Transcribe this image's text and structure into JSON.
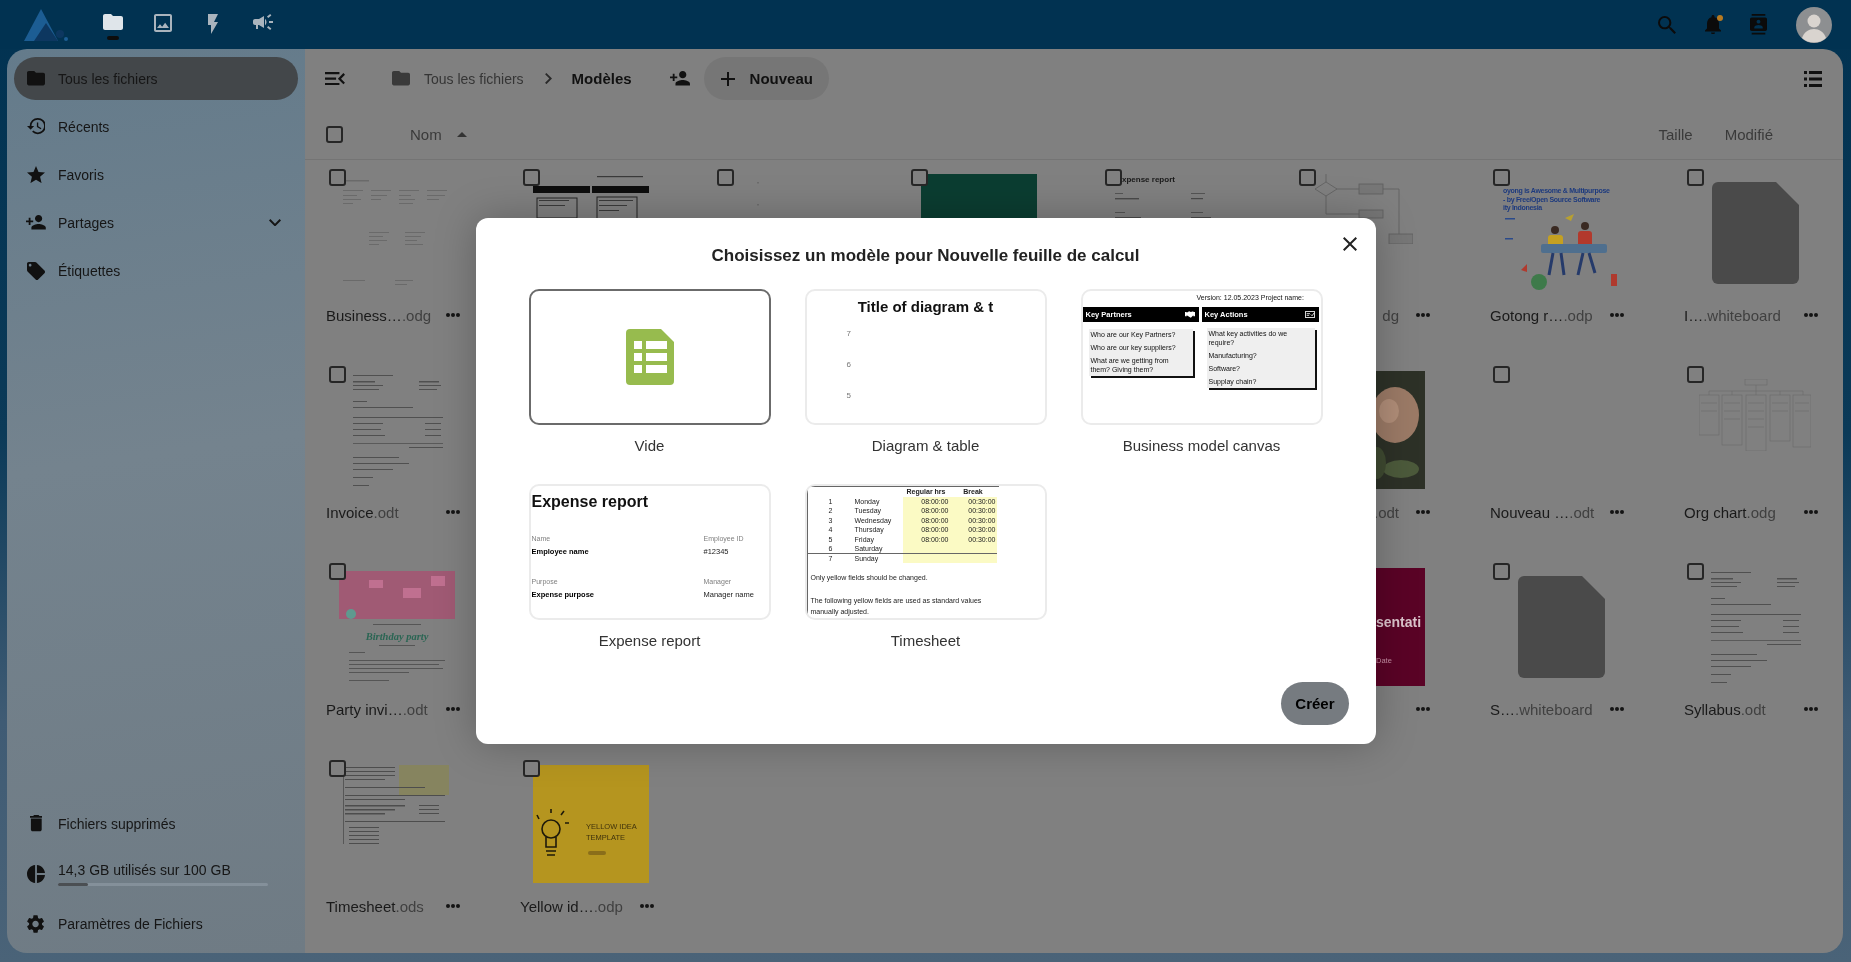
{
  "header": {
    "apps": [
      {
        "selected": true
      },
      {
        "selected": false
      },
      {
        "selected": false
      },
      {
        "selected": false
      }
    ],
    "unread_notifications": true
  },
  "sidebar": {
    "items": [
      {
        "label": "Tous les fichiers",
        "selected": true
      },
      {
        "label": "Récents",
        "selected": false
      },
      {
        "label": "Favoris",
        "selected": false
      },
      {
        "label": "Partages",
        "selected": false,
        "expanded": false
      },
      {
        "label": "Étiquettes",
        "selected": false
      }
    ],
    "trash": "Fichiers supprimés",
    "quota": {
      "label": "14,3 GB utilisés sur 100 GB",
      "level": 0.143
    },
    "settings": "Paramètres de Fichiers"
  },
  "toolbar": {
    "breadcrumbs": [
      {
        "label": "Tous les fichiers",
        "current": false
      },
      {
        "label": "Modèles",
        "current": true
      }
    ],
    "new_button": "Nouveau"
  },
  "columns": {
    "select_all": {
      "checked": false
    },
    "name": {
      "label": "Nom",
      "ascending": true
    },
    "size": "Taille",
    "modified": "Modifié"
  },
  "files": [
    {
      "left": [
        {
          "checked": false,
          "thumb": {
            "kind": "layout"
          },
          "name": "Business…",
          "ext": ".odg",
          "menu": true
        },
        {
          "checked": false,
          "thumb": {
            "kind": "canvas"
          }
        },
        {
          "checked": false,
          "thumb": {
            "kind": "chart"
          }
        },
        {
          "checked": false,
          "thumb": {
            "kind": "block",
            "color": "#0b3d31"
          }
        },
        {
          "checked": false,
          "thumb": {
            "kind": "report",
            "texts": [
              "xpense report"
            ]
          }
        },
        {
          "checked": false,
          "thumb": {
            "kind": "diagram"
          },
          "ext": "dg",
          "clipped": true,
          "menu": true
        },
        {
          "checked": false,
          "thumb": {
            "kind": "illustration",
            "texts": [
              "oyong is Awesome & Multipurpose",
              "- by Free/Open Source Software",
              "ity Indonesia"
            ]
          },
          "name": "Gotong r…",
          "ext": ".odp",
          "menu": true
        },
        {
          "checked": false,
          "thumb": {
            "kind": "file"
          },
          "name": "I…",
          "ext": ".whiteboard",
          "menu": true
        }
      ]
    },
    {
      "left": [
        {
          "checked": false,
          "thumb": {
            "kind": "document"
          },
          "name": "Invoice",
          "ext": ".odt",
          "menu": true
        }
      ],
      "right": [
        {
          "thumb": {
            "kind": "photo"
          },
          "ext": ".odt",
          "clipped": true,
          "menu": true
        },
        {
          "checked": false,
          "name": "Nouveau …",
          "ext": ".odt",
          "menu": true
        },
        {
          "checked": false,
          "thumb": {
            "kind": "orgchart"
          },
          "name": "Org chart",
          "ext": ".odg",
          "menu": true
        }
      ]
    },
    {
      "left": [
        {
          "checked": false,
          "thumb": {
            "kind": "invitation",
            "texts": [
              "Birthday party"
            ]
          },
          "name": "Party invi…",
          "ext": ".odt",
          "menu": true
        }
      ],
      "right": [
        {
          "thumb": {
            "kind": "slide",
            "color": "#5a0326",
            "texts": [
              "sentati",
              "Date"
            ]
          },
          "menu": true
        },
        {
          "checked": false,
          "thumb": {
            "kind": "file"
          },
          "name": "S…",
          "ext": ".whiteboard",
          "menu": true
        },
        {
          "checked": false,
          "thumb": {
            "kind": "document"
          },
          "name": "Syllabus",
          "ext": ".odt",
          "menu": true
        }
      ]
    },
    {
      "left": [
        {
          "checked": false,
          "thumb": {
            "kind": "timesheet"
          },
          "name": "Timesheet",
          "ext": ".ods",
          "menu": true
        },
        {
          "checked": false,
          "thumb": {
            "kind": "poster",
            "color": "#b5951f",
            "texts": [
              "YELLOW IDEA TEMPLATE"
            ]
          },
          "name": "Yellow id…",
          "ext": ".odp",
          "menu": true
        }
      ]
    }
  ],
  "dialog": {
    "title": "Choisissez un modèle pour Nouvelle feuille de calcul",
    "templates": [
      {
        "kind": "blank",
        "label": "Vide",
        "selected": true
      },
      {
        "kind": "chart",
        "label": "Diagram & table",
        "selected": false,
        "title": "Title of diagram & t",
        "ticks": [
          "7",
          "6",
          "5"
        ]
      },
      {
        "kind": "canvas",
        "label": "Business model canvas",
        "selected": false,
        "version": "Version: 12.05.2023 Project name:",
        "sections": [
          {
            "heading": "Key Partners",
            "notes": [
              "Who are our Key Partners?",
              "Who are our key suppliers?",
              "What are we getting from them? Giving them?"
            ]
          },
          {
            "heading": "Key Actions",
            "notes": [
              "What key activities do we require?",
              "Manufacturing?",
              "Software?",
              "Supplay chain?"
            ]
          }
        ]
      },
      {
        "kind": "form",
        "label": "Expense report",
        "selected": false,
        "title": "Expense report",
        "fields": [
          {
            "label": "Name",
            "value": "Employee name",
            "bold": true
          },
          {
            "label": "Employee ID",
            "value": "#12345",
            "bold": false
          },
          {
            "label": "Purpose",
            "value": "Expense purpose",
            "bold": true
          },
          {
            "label": "Manager",
            "value": "Manager name",
            "bold": false
          }
        ]
      },
      {
        "kind": "table",
        "label": "Timesheet",
        "selected": false,
        "headers": [
          "Regular hrs",
          "Break"
        ],
        "rows": [
          {
            "num": "1",
            "day": "Monday",
            "hours": "08:00:00",
            "break": "00:30:00"
          },
          {
            "num": "2",
            "day": "Tuesday",
            "hours": "08:00:00",
            "break": "00:30:00"
          },
          {
            "num": "3",
            "day": "Wednesday",
            "hours": "08:00:00",
            "break": "00:30:00"
          },
          {
            "num": "4",
            "day": "Thursday",
            "hours": "08:00:00",
            "break": "00:30:00"
          },
          {
            "num": "5",
            "day": "Friday",
            "hours": "08:00:00",
            "break": "00:30:00"
          },
          {
            "num": "6",
            "day": "Saturday"
          },
          {
            "num": "7",
            "day": "Sunday"
          }
        ],
        "notes": [
          "Only yellow fields should be changed.",
          "The following yellow fields are used as standard values manually adjusted."
        ]
      }
    ],
    "create_button": "Créer"
  }
}
